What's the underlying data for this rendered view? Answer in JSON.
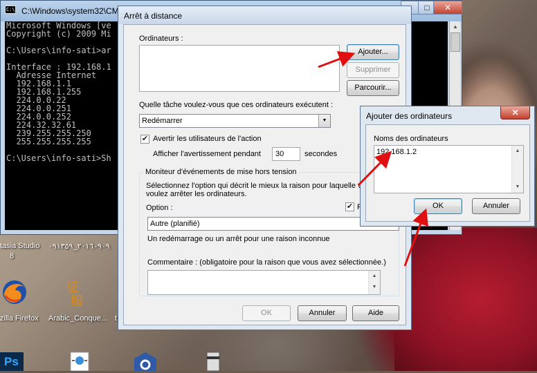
{
  "cmd": {
    "title": "C:\\Windows\\system32\\CM",
    "icon_text": "C:\\",
    "minimize": "–",
    "maximize": "□",
    "close": "✕",
    "lines": [
      "Microsoft Windows [ve",
      "Copyright (c) 2009 Mi",
      "",
      "C:\\Users\\info-sati>ar",
      "",
      "Interface : 192.168.1",
      "  Adresse Internet",
      "  192.168.1.1",
      "  192.168.1.255",
      "  224.0.0.22",
      "  224.0.0.251",
      "  224.0.0.252",
      "  224.32.32.61",
      "  239.255.255.250",
      "  255.255.255.255",
      "",
      "C:\\Users\\info-sati>Sh"
    ]
  },
  "desktop": {
    "camtasia_label": "tasia Studio",
    "camtasia_label2": "8",
    "arabic_file": "٢٠١٦٠٩٠٩_٠٩١٣٥٩",
    "firefox_label": "zilla Firefox",
    "arabic_label": "Arabic_Conque...",
    "extra_label": "t",
    "ps_label": "Ps"
  },
  "remote": {
    "title": "Arrêt à distance",
    "computers_label": "Ordinateurs :",
    "add_button": "Ajouter...",
    "remove_button": "Supprimer",
    "browse_button": "Parcourir...",
    "task_label": "Quelle tâche voulez-vous que ces ordinateurs exécutent :",
    "task_value": "Redémarrer",
    "warn_label": "Avertir les utilisateurs de l'action",
    "warn_checked": true,
    "display_warning_label": "Afficher l'avertissement pendant",
    "seconds_value": "30",
    "seconds_unit": "secondes",
    "monitor_group": "Moniteur d'événements de mise hors tension",
    "monitor_desc_1": "Sélectionnez l'option qui décrit le mieux la raison pour laquelle vo",
    "monitor_desc_2": "voulez arrêter les ordinateurs.",
    "option_label": "Option :",
    "planned_label": "P",
    "option_value": "Autre (planifié)",
    "option_desc": "Un redémarrage ou un arrêt pour une raison inconnue",
    "comment_label": "Commentaire : (obligatoire pour la raison que vous avez sélectionnée.)",
    "ok_button": "OK",
    "cancel_button": "Annuler",
    "help_button": "Aide"
  },
  "add_dialog": {
    "title": "Ajouter des ordinateurs",
    "close": "✕",
    "names_label": "Noms des ordinateurs",
    "names_value": "192.168.1.2",
    "ok_button": "OK",
    "cancel_button": "Annuler"
  },
  "icons": {
    "checkmark": "✔",
    "down_arrow": "▼",
    "up_arrow": "▲"
  },
  "colors": {
    "arrow_red": "#e01010",
    "dialog_bg": "#f0f0f0"
  }
}
